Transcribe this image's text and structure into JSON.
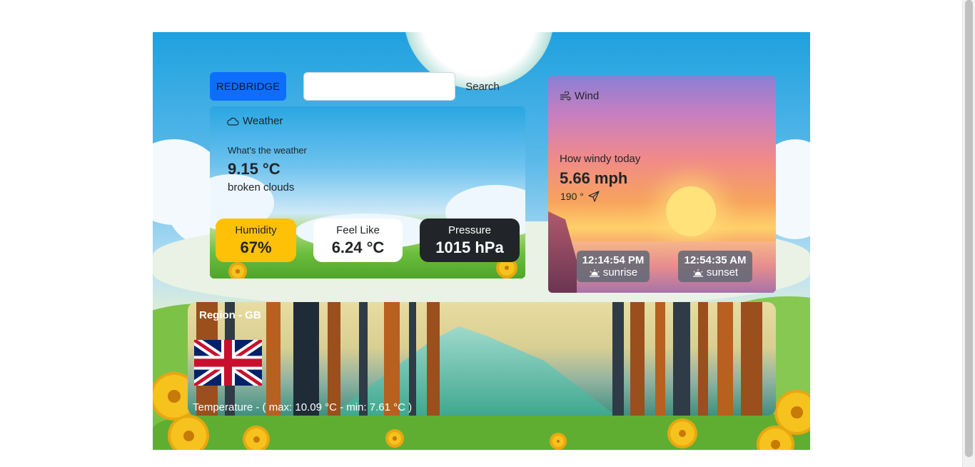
{
  "search": {
    "city_button": "REDBRIDGE",
    "input_value": "",
    "input_placeholder": "",
    "button_label": "Search"
  },
  "weather": {
    "title": "Weather",
    "subtitle": "What's the weather",
    "temperature": "9.15 °C",
    "description": "broken clouds",
    "humidity_label": "Humidity",
    "humidity_value": "67%",
    "feel_label": "Feel Like",
    "feel_value": "6.24 °C",
    "pressure_label": "Pressure",
    "pressure_value": "1015 hPa"
  },
  "wind": {
    "title": "Wind",
    "subtitle": "How windy today",
    "speed": "5.66 mph",
    "direction": "190 °",
    "sunrise_time": "12:14:54 PM",
    "sunrise_label": "sunrise",
    "sunset_time": "12:54:35 AM",
    "sunset_label": "sunset"
  },
  "region": {
    "title": "Region - GB",
    "temperature_range": "Temperature - ( max: 10.09 °C - min: 7.61 °C )"
  },
  "colors": {
    "primary": "#0d6efd",
    "humidity_bg": "#ffc107",
    "feel_bg": "#ffffff",
    "pressure_bg": "#212529",
    "pill_bg": "#606876"
  },
  "icons": {
    "weather": "cloud-icon",
    "wind": "wind-icon",
    "direction": "send-arrow-icon",
    "sunrise": "sunrise-icon",
    "sunset": "sunset-icon",
    "flag": "uk-flag"
  }
}
